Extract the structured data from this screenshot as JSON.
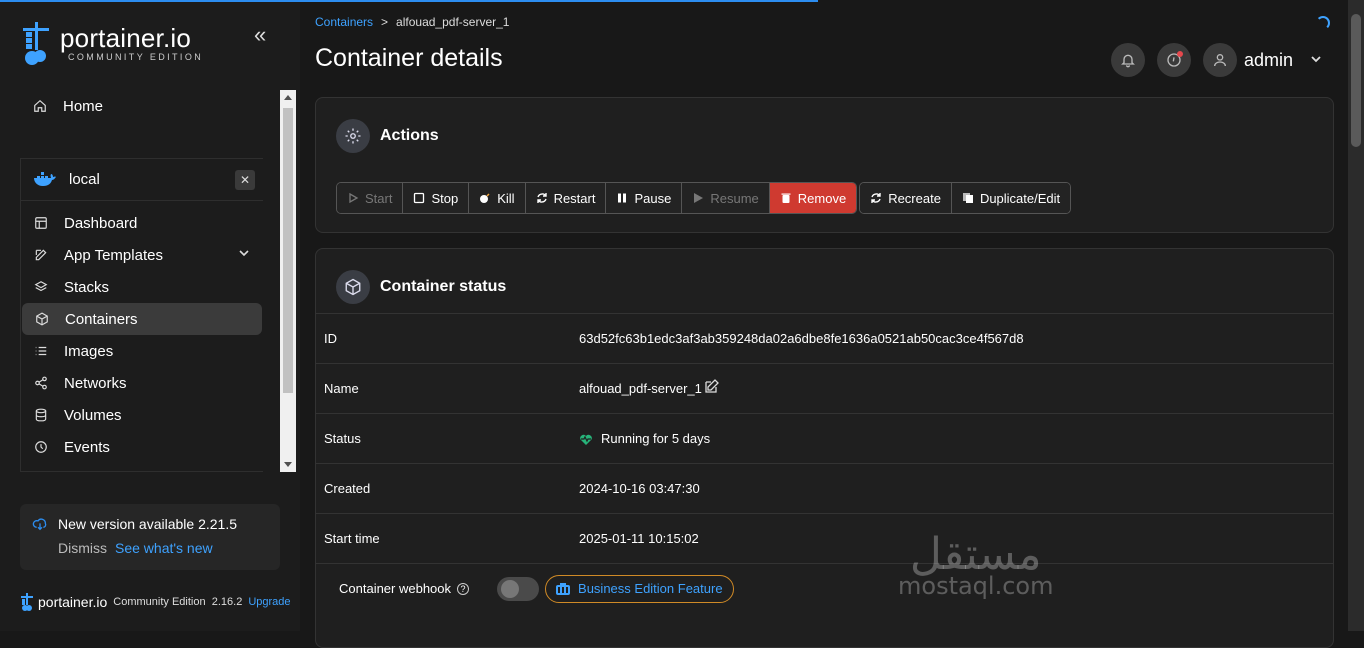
{
  "colors": {
    "accent": "#2c8df0",
    "danger": "#cf3a30",
    "link": "#3ea2ff",
    "status_ok": "#27b47a"
  },
  "brand": {
    "name": "portainer.io",
    "edition": "COMMUNITY EDITION"
  },
  "sidebar": {
    "home": "Home",
    "environment": "local",
    "close": "✕",
    "items": [
      {
        "label": "Dashboard",
        "icon": "dashboard-icon"
      },
      {
        "label": "App Templates",
        "icon": "edit-icon",
        "has_submenu": true
      },
      {
        "label": "Stacks",
        "icon": "layers-icon"
      },
      {
        "label": "Containers",
        "icon": "cube-icon",
        "active": true
      },
      {
        "label": "Images",
        "icon": "list-icon"
      },
      {
        "label": "Networks",
        "icon": "share-icon"
      },
      {
        "label": "Volumes",
        "icon": "database-icon"
      },
      {
        "label": "Events",
        "icon": "clock-icon"
      }
    ],
    "update": {
      "title": "New version available 2.21.5",
      "dismiss": "Dismiss",
      "whats_new": "See what's new"
    },
    "footer": {
      "name": "portainer.io",
      "edition": "Community Edition",
      "version": "2.16.2",
      "upgrade": "Upgrade"
    }
  },
  "header": {
    "breadcrumb": {
      "parent": "Containers",
      "separator": ">",
      "current": "alfouad_pdf-server_1"
    },
    "title": "Container details",
    "user": "admin"
  },
  "actions": {
    "title": "Actions",
    "buttons": {
      "start": "Start",
      "stop": "Stop",
      "kill": "Kill",
      "restart": "Restart",
      "pause": "Pause",
      "resume": "Resume",
      "remove": "Remove",
      "recreate": "Recreate",
      "duplicate": "Duplicate/Edit"
    }
  },
  "status": {
    "title": "Container status",
    "rows": [
      {
        "key": "ID",
        "value": "63d52fc63b1edc3af3ab359248da02a6dbe8fe1636a0521ab50cac3ce4f567d8"
      },
      {
        "key": "Name",
        "value": "alfouad_pdf-server_1"
      },
      {
        "key": "Status",
        "value": "Running for 5 days"
      },
      {
        "key": "Created",
        "value": "2024-10-16 03:47:30"
      },
      {
        "key": "Start time",
        "value": "2025-01-11 10:15:02"
      }
    ],
    "webhook": {
      "label": "Container webhook",
      "feature": "Business Edition Feature"
    }
  },
  "watermark": {
    "arabic": "مستقل",
    "latin": "mostaql.com"
  }
}
